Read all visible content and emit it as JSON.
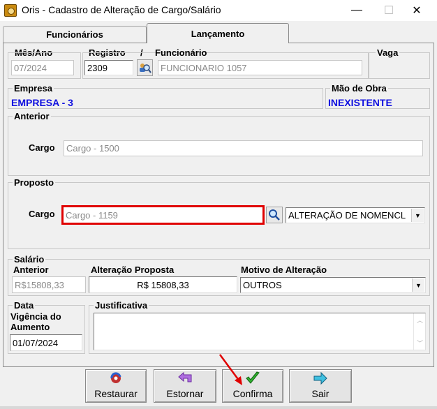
{
  "window": {
    "title": "Oris - Cadastro de Alteração de Cargo/Salário",
    "minimize": "—",
    "maximize": "☐",
    "close": "✕"
  },
  "tabs": [
    "Funcionários",
    "Lançamento"
  ],
  "header": {
    "mes_ano_label": "Mês/Ano",
    "mes_ano_value": "07/2024",
    "registro_label": "Registro",
    "slash": "/",
    "registro_value": "2309",
    "funcionario_label": "Funcionário",
    "funcionario_value": "FUNCIONARIO 1057",
    "vaga_label": "Vaga"
  },
  "empresa": {
    "label": "Empresa",
    "value": "EMPRESA - 3"
  },
  "mao_de_obra": {
    "label": "Mão de Obra",
    "value": "INEXISTENTE"
  },
  "anterior": {
    "label": "Anterior",
    "cargo_label": "Cargo",
    "cargo_value": "Cargo - 1500"
  },
  "proposto": {
    "label": "Proposto",
    "cargo_label": "Cargo",
    "cargo_value": "Cargo - 1159",
    "motivo_value": "ALTERAÇÃO DE NOMENCL"
  },
  "salario": {
    "label": "Salário",
    "anterior_label": "Anterior",
    "anterior_value": "R$15808,33",
    "alteracao_label": "Alteração Proposta",
    "alteracao_value": "R$ 15808,33",
    "motivo_label": "Motivo de Alteração",
    "motivo_value": "OUTROS"
  },
  "data": {
    "label": "Data",
    "vigencia_label_1": "Vigência do",
    "vigencia_label_2": "Aumento",
    "vigencia_value": "01/07/2024"
  },
  "justificativa": {
    "label": "Justificativa",
    "value": ""
  },
  "buttons": {
    "restaurar": "Restaurar",
    "estornar": "Estornar",
    "confirma": "Confirma",
    "sair": "Sair"
  },
  "colors": {
    "highlight": "#e00000",
    "blue_text": "#1010e0",
    "arrow": "#e00000"
  }
}
